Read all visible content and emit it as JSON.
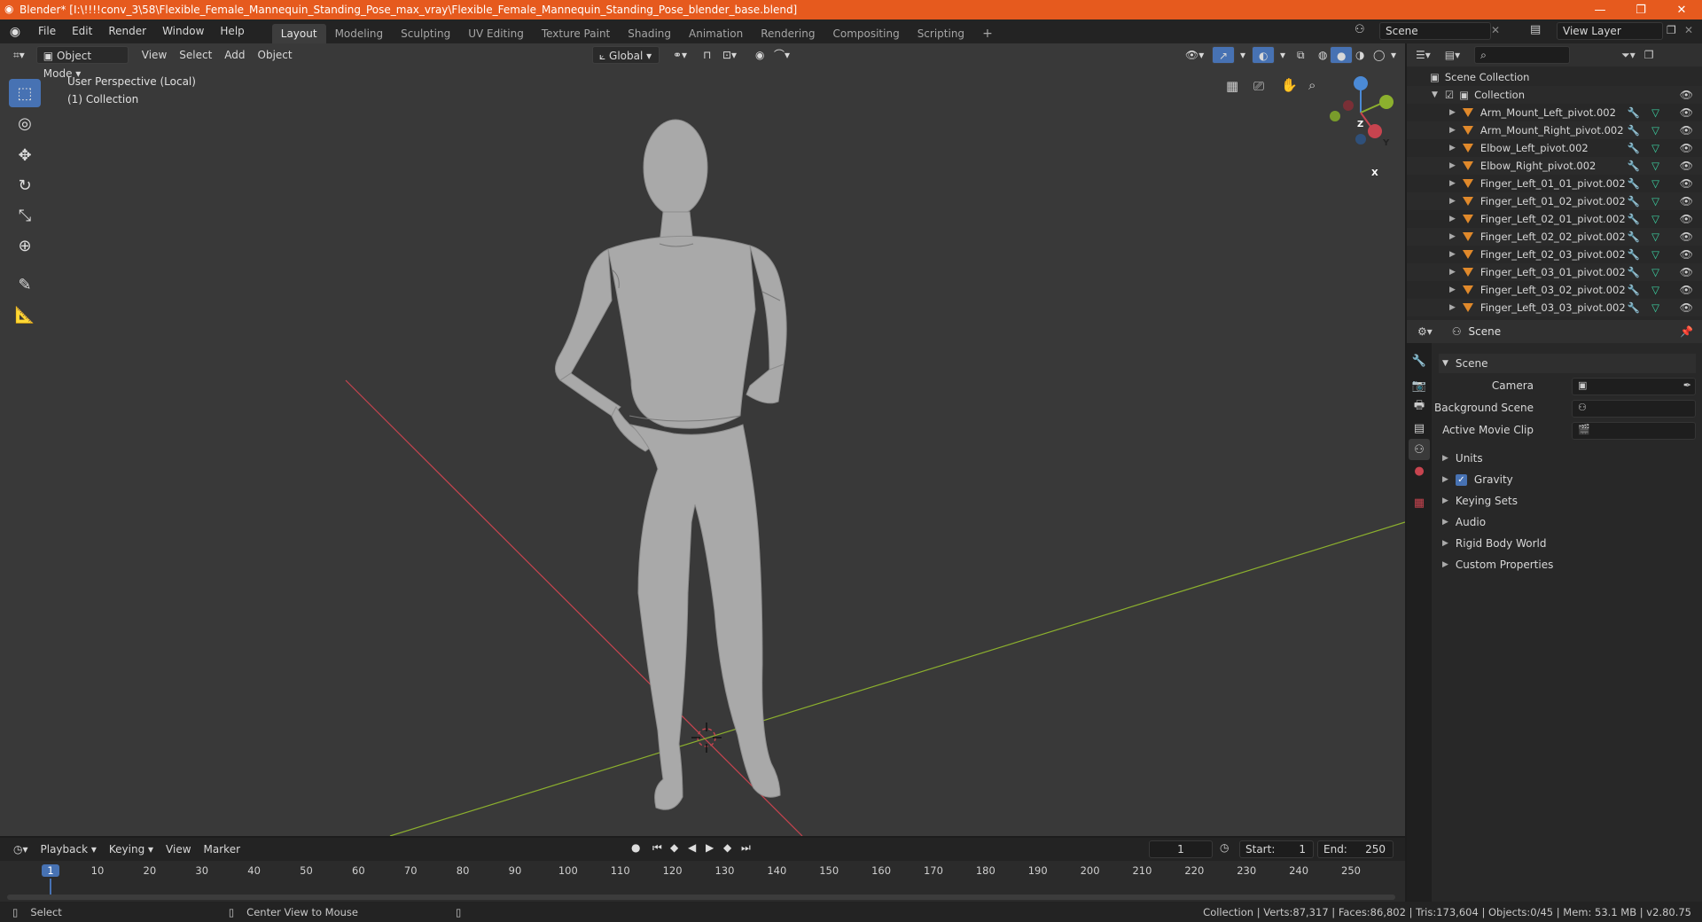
{
  "window": {
    "title": "Blender* [I:\\!!!!conv_3\\58\\Flexible_Female_Mannequin_Standing_Pose_max_vray\\Flexible_Female_Mannequin_Standing_Pose_blender_base.blend]"
  },
  "menu": [
    "File",
    "Edit",
    "Render",
    "Window",
    "Help"
  ],
  "workspaces": [
    "Layout",
    "Modeling",
    "Sculpting",
    "UV Editing",
    "Texture Paint",
    "Shading",
    "Animation",
    "Rendering",
    "Compositing",
    "Scripting"
  ],
  "active_workspace": "Layout",
  "scene_selector": "Scene",
  "view_layer_selector": "View Layer",
  "viewport": {
    "mode": "Object Mode",
    "menus": [
      "View",
      "Select",
      "Add",
      "Object"
    ],
    "transform_orientation": "Global",
    "overlay_line1": "User Perspective (Local)",
    "overlay_line2": "(1) Collection",
    "gizmo_axes": [
      "Z",
      "Y",
      "X"
    ]
  },
  "outliner": {
    "root": "Scene Collection",
    "collection": "Collection",
    "items": [
      "Arm_Mount_Left_pivot.002",
      "Arm_Mount_Right_pivot.002",
      "Elbow_Left_pivot.002",
      "Elbow_Right_pivot.002",
      "Finger_Left_01_01_pivot.002",
      "Finger_Left_01_02_pivot.002",
      "Finger_Left_02_01_pivot.002",
      "Finger_Left_02_02_pivot.002",
      "Finger_Left_02_03_pivot.002",
      "Finger_Left_03_01_pivot.002",
      "Finger_Left_03_02_pivot.002",
      "Finger_Left_03_03_pivot.002"
    ]
  },
  "properties": {
    "context": "Scene",
    "panel_title": "Scene",
    "fields": [
      {
        "label": "Camera"
      },
      {
        "label": "Background Scene"
      },
      {
        "label": "Active Movie Clip"
      }
    ],
    "subpanels": [
      "Units",
      "Gravity",
      "Keying Sets",
      "Audio",
      "Rigid Body World",
      "Custom Properties"
    ],
    "gravity_checked": true
  },
  "timeline": {
    "menus": [
      "Playback",
      "Keying",
      "View",
      "Marker"
    ],
    "current_frame": "1",
    "start_label": "Start:",
    "start": "1",
    "end_label": "End:",
    "end": "250",
    "ticks": [
      "1",
      "10",
      "20",
      "30",
      "40",
      "50",
      "60",
      "70",
      "80",
      "90",
      "100",
      "110",
      "120",
      "130",
      "140",
      "150",
      "160",
      "170",
      "180",
      "190",
      "200",
      "210",
      "220",
      "230",
      "240",
      "250"
    ]
  },
  "statusbar": {
    "left": "Select",
    "middle": "Center View to Mouse",
    "right": "Collection | Verts:87,317 | Faces:86,802 | Tris:173,604 | Objects:0/45 | Mem: 53.1 MB | v2.80.75"
  },
  "colors": {
    "titlebar": "#e65a1e",
    "accent": "#4772b3",
    "x_axis": "#c7444f",
    "y_axis": "#8cb02e",
    "z_axis": "#4b8ad6",
    "mesh_icon": "#e0892b",
    "modifier_icon": "#6fa8dc",
    "mesh_data_icon": "#3cd2a2"
  }
}
